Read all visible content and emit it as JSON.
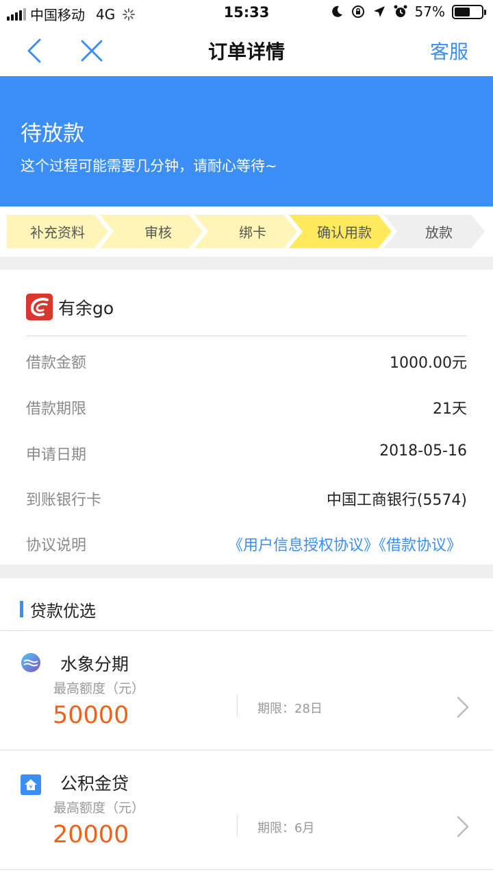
{
  "status_bar": {
    "carrier": "中国移动",
    "network": "4G",
    "time": "15:33",
    "battery": "57%",
    "battery_level": 0.57
  },
  "nav": {
    "title": "订单详情",
    "service": "客服"
  },
  "banner": {
    "title": "待放款",
    "subtitle": "这个过程可能需要几分钟，请耐心等待~"
  },
  "steps": [
    {
      "label": "补充资料",
      "color": "#fff5b8"
    },
    {
      "label": "审核",
      "color": "#fff5b8"
    },
    {
      "label": "绑卡",
      "color": "#fff5b8"
    },
    {
      "label": "确认用款",
      "color": "#ffe95c"
    },
    {
      "label": "放款",
      "color": "#efefef"
    }
  ],
  "order": {
    "brand": "有余go",
    "rows": [
      {
        "label": "借款金额",
        "value": "1000.00元"
      },
      {
        "label": "借款期限",
        "value": "21天"
      },
      {
        "label": "申请日期",
        "value": "2018-05-16"
      },
      {
        "label": "到账银行卡",
        "value": "中国工商银行(5574)"
      },
      {
        "label": "协议说明",
        "value": "《用户信息授权协议》《借款协议》"
      }
    ]
  },
  "recommend": {
    "title": "贷款优选",
    "loans": [
      {
        "name": "水象分期",
        "max_label": "最高额度（元）",
        "amount": "50000",
        "term": "期限：28日",
        "icon": "wave-icon"
      },
      {
        "name": "公积金贷",
        "max_label": "最高额度（元）",
        "amount": "20000",
        "term": "期限：6月",
        "icon": "house-icon"
      }
    ]
  },
  "colors": {
    "accent": "#3a8ef5",
    "amount": "#f0621a",
    "brand_logo": "#d8362e"
  }
}
